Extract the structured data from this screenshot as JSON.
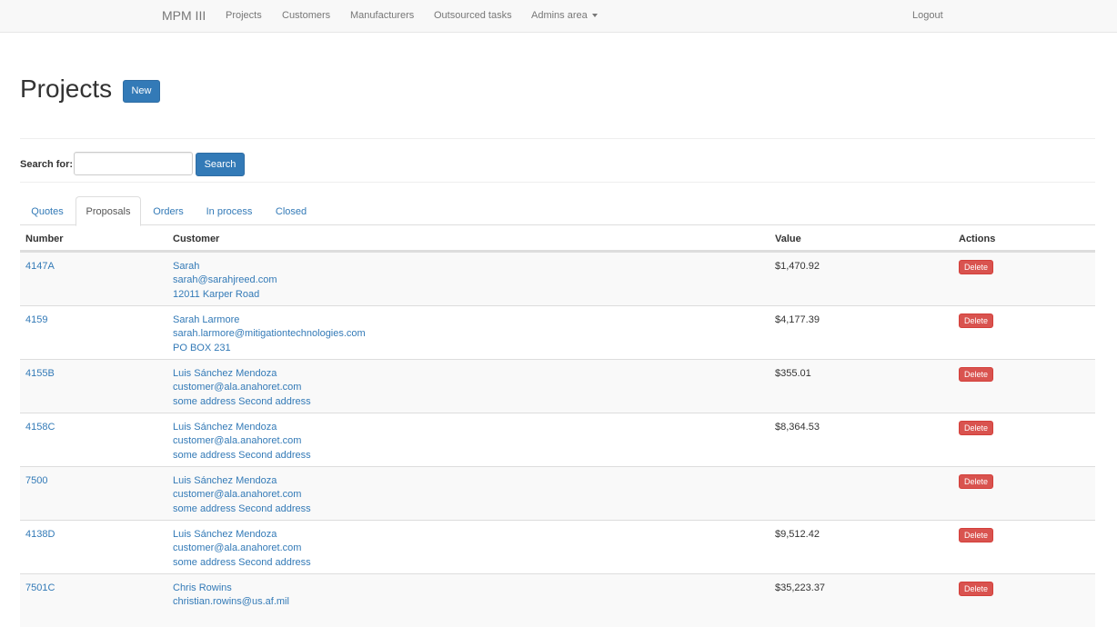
{
  "nav": {
    "brand": "MPM III",
    "items": [
      "Projects",
      "Customers",
      "Manufacturers",
      "Outsourced tasks",
      "Admins area"
    ],
    "logout": "Logout"
  },
  "header": {
    "title": "Projects",
    "new_label": "New"
  },
  "search": {
    "label": "Search for:",
    "value": "",
    "button": "Search"
  },
  "tabs": [
    "Quotes",
    "Proposals",
    "Orders",
    "In process",
    "Closed"
  ],
  "active_tab": "Proposals",
  "table": {
    "headers": [
      "Number",
      "Customer",
      "Value",
      "Actions"
    ],
    "delete_label": "Delete",
    "rows": [
      {
        "number": "4147A",
        "name": "Sarah",
        "email": "sarah@sarahjreed.com",
        "address": "12011 Karper Road",
        "value": "$1,470.92"
      },
      {
        "number": "4159",
        "name": "Sarah Larmore",
        "email": "sarah.larmore@mitigationtechnologies.com",
        "address": "PO BOX 231",
        "value": "$4,177.39"
      },
      {
        "number": "4155B",
        "name": "Luis Sánchez Mendoza",
        "email": "customer@ala.anahoret.com",
        "address": "some address Second address",
        "value": "$355.01"
      },
      {
        "number": "4158C",
        "name": "Luis Sánchez Mendoza",
        "email": "customer@ala.anahoret.com",
        "address": "some address Second address",
        "value": "$8,364.53"
      },
      {
        "number": "7500",
        "name": "Luis Sánchez Mendoza",
        "email": "customer@ala.anahoret.com",
        "address": "some address Second address",
        "value": ""
      },
      {
        "number": "4138D",
        "name": "Luis Sánchez Mendoza",
        "email": "customer@ala.anahoret.com",
        "address": "some address Second address",
        "value": "$9,512.42"
      },
      {
        "number": "7501C",
        "name": "Chris Rowins",
        "email": "christian.rowins@us.af.mil",
        "address": "",
        "value": "$35,223.37"
      }
    ]
  },
  "colors": {
    "link": "#337ab7",
    "primary": "#337ab7",
    "danger": "#d9534f",
    "navbar_bg": "#f8f8f8"
  }
}
